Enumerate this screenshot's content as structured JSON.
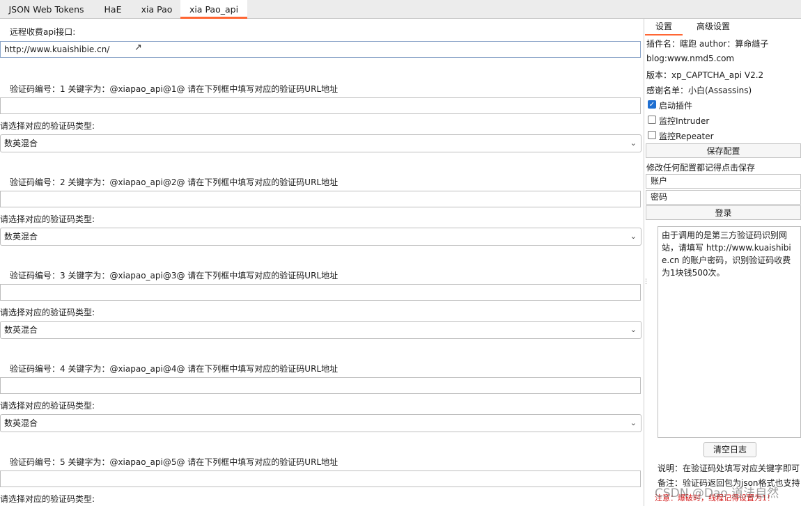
{
  "tabs": [
    "JSON Web Tokens",
    "HaE",
    "xia Pao",
    "xia Pao_api"
  ],
  "remote": {
    "label": "远程收费api接口:",
    "url_value": "http://www.kuaishibie.cn/"
  },
  "captcha_blocks": [
    {
      "heading": "验证码编号：1  关键字为：@xiapao_api@1@     请在下列框中填写对应的验证码URL地址",
      "url_value": "",
      "type_label": "请选择对应的验证码类型:",
      "type_value": "数英混合"
    },
    {
      "heading": "验证码编号：2  关键字为：@xiapao_api@2@     请在下列框中填写对应的验证码URL地址",
      "url_value": "",
      "type_label": "请选择对应的验证码类型:",
      "type_value": "数英混合"
    },
    {
      "heading": "验证码编号：3  关键字为：@xiapao_api@3@     请在下列框中填写对应的验证码URL地址",
      "url_value": "",
      "type_label": "请选择对应的验证码类型:",
      "type_value": "数英混合"
    },
    {
      "heading": "验证码编号：4  关键字为：@xiapao_api@4@     请在下列框中填写对应的验证码URL地址",
      "url_value": "",
      "type_label": "请选择对应的验证码类型:",
      "type_value": "数英混合"
    },
    {
      "heading": "验证码编号：5  关键字为：@xiapao_api@5@     请在下列框中填写对应的验证码URL地址",
      "url_value": "",
      "type_label": "请选择对应的验证码类型:"
    }
  ],
  "settings": {
    "tabs": [
      "设置",
      "高级设置"
    ],
    "plugin_line": "插件名：瞎跑 author：算命縫子",
    "blog": "blog:www.nmd5.com",
    "version": "版本：xp_CAPTCHA_api V2.2",
    "thanks": "感谢名单：小白(Assassins)",
    "checkboxes": [
      {
        "label": "启动插件",
        "checked": true
      },
      {
        "label": "监控Intruder",
        "checked": false
      },
      {
        "label": "监控Repeater",
        "checked": false
      }
    ],
    "save_button": "保存配置",
    "save_hint": "修改任何配置都记得点击保存",
    "account_placeholder": "账户",
    "password_placeholder": "密码",
    "login_button": "登录",
    "log_text": "由于调用的是第三方验证码识别网站，请填写 http://www.kuaishibie.cn 的账户密码，识别验证码收费为1块钱500次。",
    "clear_button": "清空日志",
    "note1": "说明：在验证码处填写对应关键字即可",
    "note2": "备注：验证码返回包为json格式也支持",
    "warning": "注意：爆破时，线程记得设置为1！",
    "watermark": "CSDN @Dao 道法自然"
  },
  "icons": {
    "chevron": "chevron-down-icon",
    "check": "check-icon",
    "cursor": "mouse-cursor-icon"
  },
  "colors": {
    "accent": "#ff6633",
    "checkbox": "#1f6fd1",
    "warning": "#d41a1a"
  }
}
